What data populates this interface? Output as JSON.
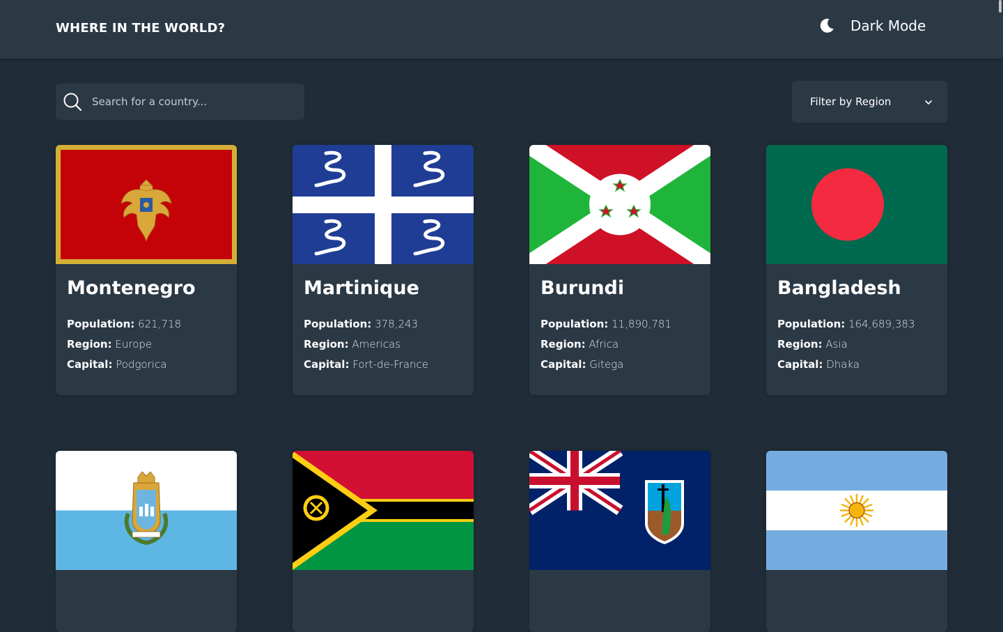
{
  "header": {
    "title": "WHERE IN THE WORLD?",
    "mode_label": "Dark Mode",
    "mode_icon": "moon-icon"
  },
  "search": {
    "placeholder": "Search for a country...",
    "value": "",
    "icon": "search-icon"
  },
  "filter": {
    "label": "Filter by Region",
    "icon": "chevron-down-icon"
  },
  "labels": {
    "population": "Population:",
    "region": "Region:",
    "capital": "Capital:"
  },
  "countries": [
    {
      "name": "Montenegro",
      "population": "621,718",
      "region": "Europe",
      "capital": "Podgorica",
      "flag": "montenegro-flag"
    },
    {
      "name": "Martinique",
      "population": "378,243",
      "region": "Americas",
      "capital": "Fort-de-France",
      "flag": "martinique-flag"
    },
    {
      "name": "Burundi",
      "population": "11,890,781",
      "region": "Africa",
      "capital": "Gitega",
      "flag": "burundi-flag"
    },
    {
      "name": "Bangladesh",
      "population": "164,689,383",
      "region": "Asia",
      "capital": "Dhaka",
      "flag": "bangladesh-flag"
    },
    {
      "flag": "san-marino-flag"
    },
    {
      "flag": "vanuatu-flag"
    },
    {
      "flag": "montserrat-flag"
    },
    {
      "flag": "argentina-flag"
    }
  ],
  "colors": {
    "background": "#202c37",
    "elements": "#2b3945",
    "text": "#ffffff"
  }
}
